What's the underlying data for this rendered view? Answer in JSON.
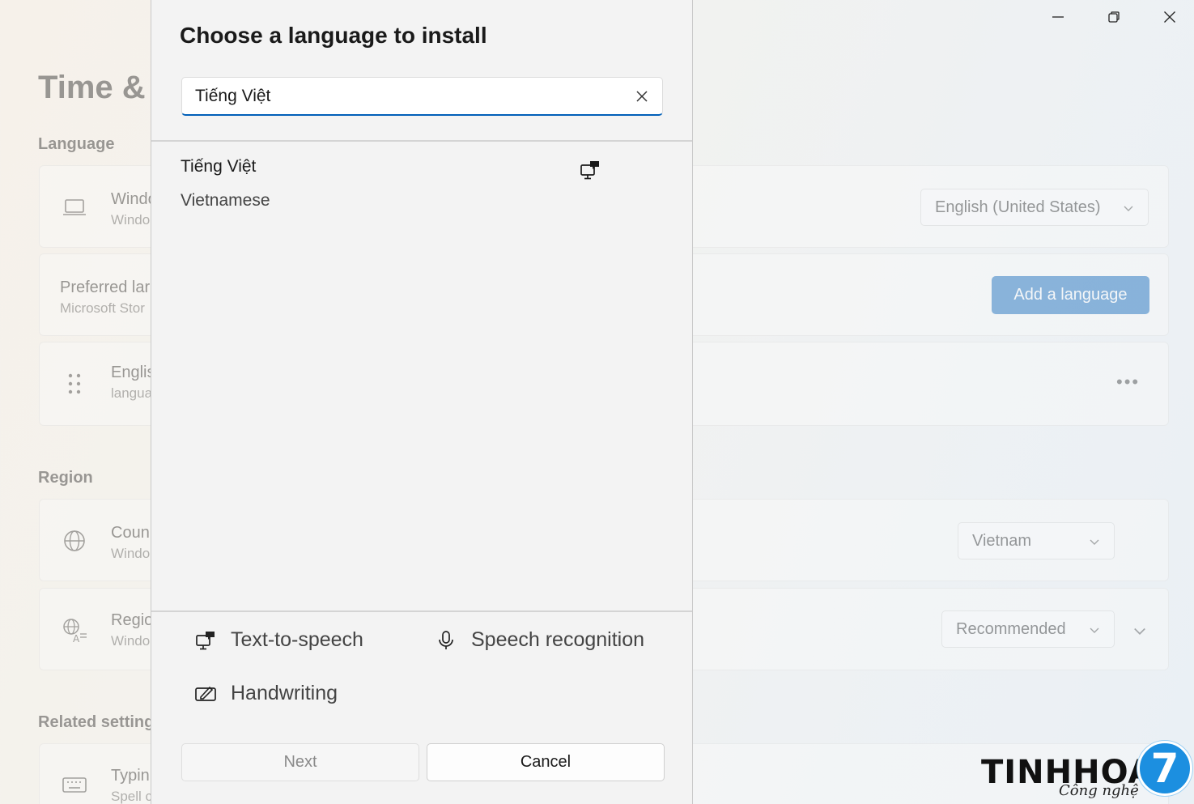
{
  "window_controls": {
    "minimize": "minimize-icon",
    "maximize": "restore-icon",
    "close": "close-icon"
  },
  "background": {
    "page_title": "Time & ",
    "sections": {
      "language": "Language",
      "region": "Region",
      "related": "Related setting"
    },
    "cards": {
      "display_language": {
        "title": "Windo",
        "subtitle": "Windo",
        "value": "English (United States)"
      },
      "preferred": {
        "title": "Preferred lar",
        "subtitle": "Microsoft Stor",
        "button": "Add a language"
      },
      "english": {
        "title": "Englis",
        "subtitle": "langua",
        "more": "•••"
      },
      "country": {
        "title": "Coun",
        "subtitle": "Windo",
        "value": "Vietnam"
      },
      "regional": {
        "title": "Regio",
        "subtitle": "Windo",
        "value": "Recommended"
      },
      "typing": {
        "title": "Typin",
        "subtitle": "Spell c"
      }
    }
  },
  "dialog": {
    "title": "Choose a language to install",
    "search_value": "Tiếng Việt",
    "results": [
      {
        "native": "Tiếng Việt",
        "english": "Vietnamese"
      }
    ],
    "features": {
      "tts": "Text-to-speech",
      "speech": "Speech recognition",
      "handwriting": "Handwriting"
    },
    "next_label": "Next",
    "cancel_label": "Cancel"
  },
  "logo": {
    "word": "TINHHOA",
    "sub": "Công nghệ",
    "badge": "7"
  },
  "colors": {
    "accent": "#005fb8",
    "logo_blue": "#1c8fe0"
  }
}
